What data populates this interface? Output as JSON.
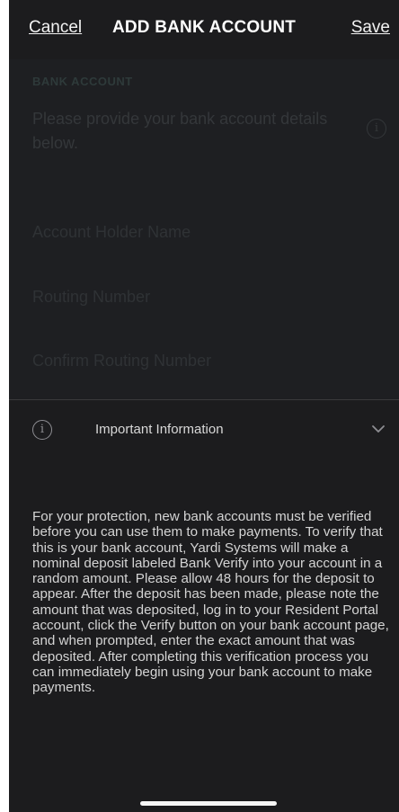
{
  "navbar": {
    "cancel_label": "Cancel",
    "title": "ADD BANK ACCOUNT",
    "save_label": "Save"
  },
  "form": {
    "section_label": "BANK ACCOUNT",
    "intro": "Please provide your bank account details below.",
    "fields": [
      {
        "placeholder": "Account Holder Name"
      },
      {
        "placeholder": "Routing Number"
      },
      {
        "placeholder": "Confirm Routing Number"
      }
    ]
  },
  "important_info": {
    "title": "Important Information",
    "icon": "info-icon",
    "chevron": "chevron-down-icon",
    "expanded": true,
    "body": "For your protection, new bank accounts must be verified before you can use them to make payments. To verify that this is your bank account, Yardi Systems will make a nominal deposit labeled Bank Verify into your account in a random amount. Please allow 48 hours for the deposit to appear. After the deposit has been made, please note the amount that was deposited, log in to your Resident Portal account, click the Verify button on your bank account page, and when prompted, enter the exact amount that was deposited. After completing this verification process you can immediately begin using your bank account to make payments."
  },
  "colors": {
    "background": "#1c1c1e",
    "text": "#d4d4d4",
    "dimmed_text": "#34373a"
  }
}
